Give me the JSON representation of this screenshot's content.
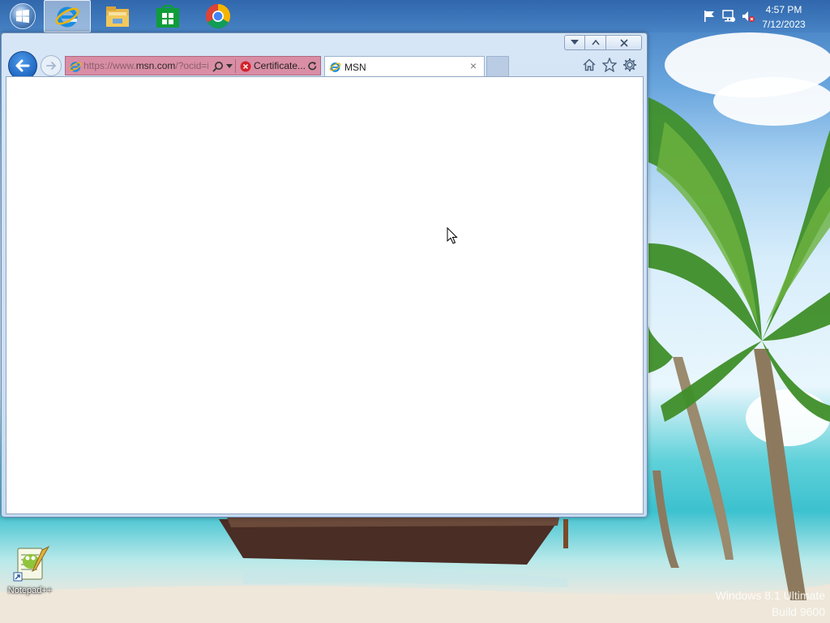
{
  "taskbar": {
    "start": {
      "icon": "windows-logo-icon"
    },
    "pinned": [
      {
        "name": "internet-explorer",
        "icon": "internet-explorer-icon",
        "active": true
      },
      {
        "name": "file-explorer",
        "icon": "folder-icon",
        "active": false
      },
      {
        "name": "store",
        "icon": "store-icon",
        "active": false
      },
      {
        "name": "chrome",
        "icon": "chrome-icon",
        "active": false
      }
    ],
    "tray": {
      "icons": [
        "action-center-flag-icon",
        "network-icon",
        "volume-muted-icon"
      ],
      "time": "4:57 PM",
      "date": "7/12/2023"
    }
  },
  "browser": {
    "address": {
      "url_prefix": "https://www.",
      "url_domain": "msn.com",
      "url_suffix": "/?ocid=ie",
      "certificate_text": "Certificate..."
    },
    "tabs": [
      {
        "title": "MSN",
        "close": "×"
      }
    ],
    "toolbar_icons": [
      "home-icon",
      "favorites-star-icon",
      "tools-gear-icon"
    ]
  },
  "desktop": {
    "icons": [
      {
        "label": "Notepad++"
      }
    ],
    "watermark": {
      "line1": "Windows 8.1 Ultimate",
      "line2": "Build 9600"
    }
  },
  "colors": {
    "address_bar_error": "#d98ea6",
    "back_button": "#1f66c2",
    "window_frame": "#c6dbf1"
  }
}
